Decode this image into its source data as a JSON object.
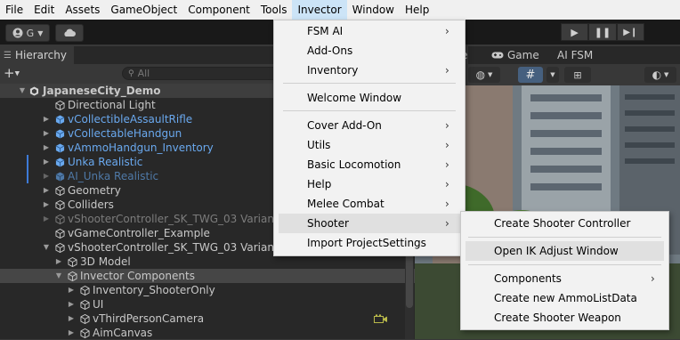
{
  "menubar": [
    "File",
    "Edit",
    "Assets",
    "GameObject",
    "Component",
    "Tools",
    "Invector",
    "Window",
    "Help"
  ],
  "toolbar": {
    "account_label": "G"
  },
  "hierarchy": {
    "tab_label": "Hierarchy",
    "search_placeholder": "All",
    "rows": [
      {
        "label": "JapaneseCity_Demo",
        "kind": "scene"
      },
      {
        "label": "Directional Light"
      },
      {
        "label": "vCollectibleAssaultRifle"
      },
      {
        "label": "vCollectableHandgun"
      },
      {
        "label": "vAmmoHandgun_Inventory"
      },
      {
        "label": "Unka Realistic"
      },
      {
        "label": "AI_Unka Realistic"
      },
      {
        "label": "Geometry"
      },
      {
        "label": "Colliders"
      },
      {
        "label": "vShooterController_SK_TWG_03 Variant"
      },
      {
        "label": "vGameController_Example"
      },
      {
        "label": "vShooterController_SK_TWG_03 Variant"
      },
      {
        "label": "3D Model"
      },
      {
        "label": "Invector Components"
      },
      {
        "label": "Inventory_ShooterOnly"
      },
      {
        "label": "UI"
      },
      {
        "label": "vThirdPersonCamera"
      },
      {
        "label": "AimCanvas"
      }
    ]
  },
  "scene_tabs": {
    "scene": "e",
    "game": "Game",
    "ai_fsm": "AI FSM"
  },
  "invector_menu": {
    "items": [
      "FSM AI",
      "Add-Ons",
      "Inventory",
      "Welcome Window",
      "Cover Add-On",
      "Utils",
      "Basic Locomotion",
      "Help",
      "Melee Combat",
      "Shooter",
      "Import ProjectSettings"
    ],
    "highlighted": "Shooter"
  },
  "shooter_submenu": {
    "items": [
      "Create Shooter Controller",
      "Open IK Adjust Window",
      "Components",
      "Create new AmmoListData",
      "Create Shooter Weapon"
    ],
    "highlighted": "Open IK Adjust Window"
  },
  "colors": {
    "accent_blue": "#3d7bd8",
    "prefab_blue": "#6aa9ef",
    "menu_bg": "#f2f2f2",
    "editor_bg": "#282828"
  }
}
